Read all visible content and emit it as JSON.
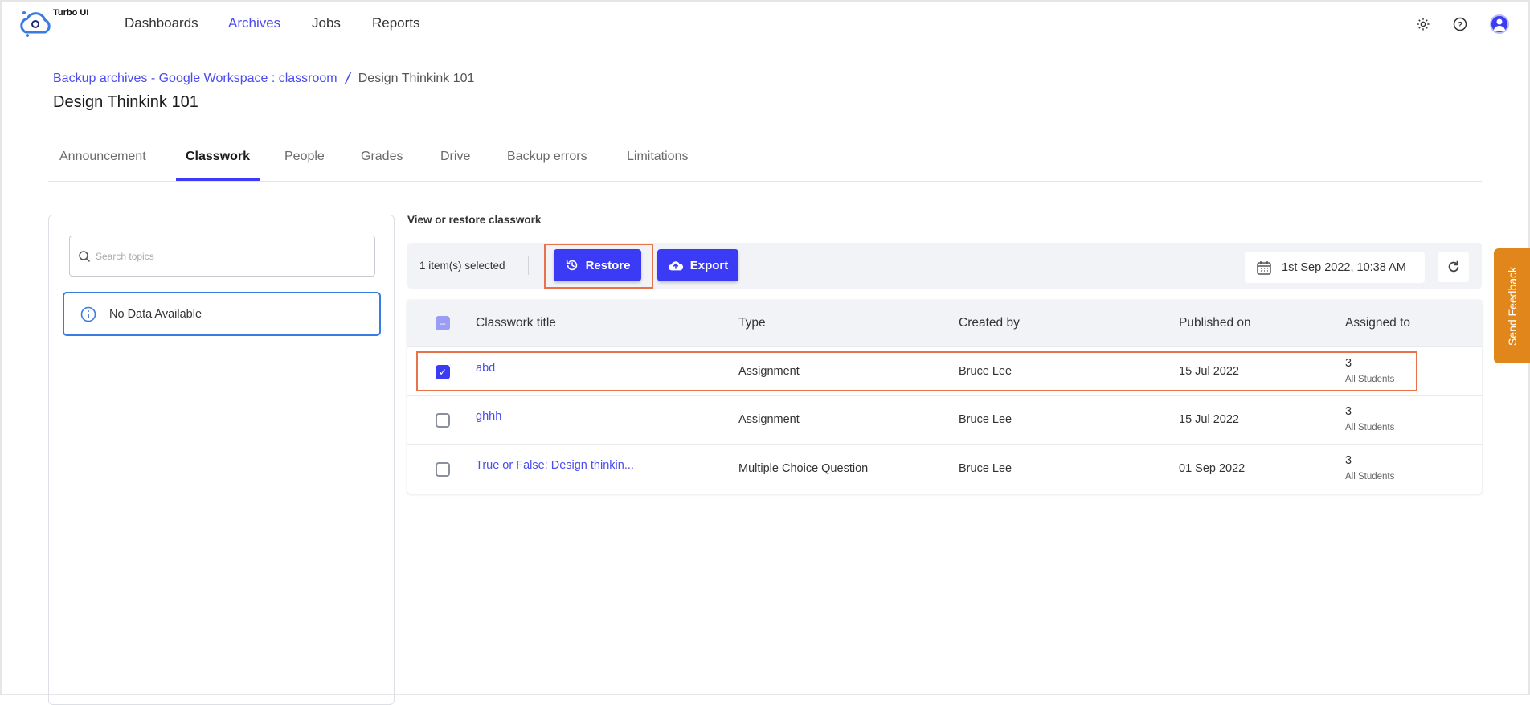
{
  "app": {
    "name": "Turbo UI"
  },
  "nav": {
    "items": [
      "Dashboards",
      "Archives",
      "Jobs",
      "Reports"
    ],
    "active": "Archives"
  },
  "breadcrumb": {
    "parent": "Backup archives - Google Workspace : classroom",
    "separator": "/",
    "current": "Design Thinkink 101"
  },
  "page_title": "Design Thinkink 101",
  "tabs": [
    "Announcement",
    "Classwork",
    "People",
    "Grades",
    "Drive",
    "Backup errors",
    "Limitations"
  ],
  "sidebar": {
    "search_placeholder": "Search topics",
    "empty_text": "No Data Available"
  },
  "main": {
    "heading": "View or restore classwork",
    "selected_text": "1 item(s) selected",
    "restore_label": "Restore",
    "export_label": "Export",
    "date": "1st Sep 2022, 10:38 AM",
    "columns": [
      "Classwork title",
      "Type",
      "Created by",
      "Published on",
      "Assigned to"
    ],
    "rows": [
      {
        "title": "abd",
        "type": "Assignment",
        "created_by": "Bruce Lee",
        "published": "15 Jul 2022",
        "assigned_count": "3",
        "assigned_label": "All Students",
        "checked": true
      },
      {
        "title": "ghhh",
        "type": "Assignment",
        "created_by": "Bruce Lee",
        "published": "15 Jul 2022",
        "assigned_count": "3",
        "assigned_label": "All Students",
        "checked": false
      },
      {
        "title": "True or False: Design thinkin...",
        "type": "Multiple Choice Question",
        "created_by": "Bruce Lee",
        "published": "01 Sep 2022",
        "assigned_count": "3",
        "assigned_label": "All Students",
        "checked": false
      }
    ]
  },
  "feedback_label": "Send Feedback",
  "colors": {
    "accent": "#3b3bf5",
    "highlight": "#e8734a",
    "feedback": "#e0861a"
  }
}
